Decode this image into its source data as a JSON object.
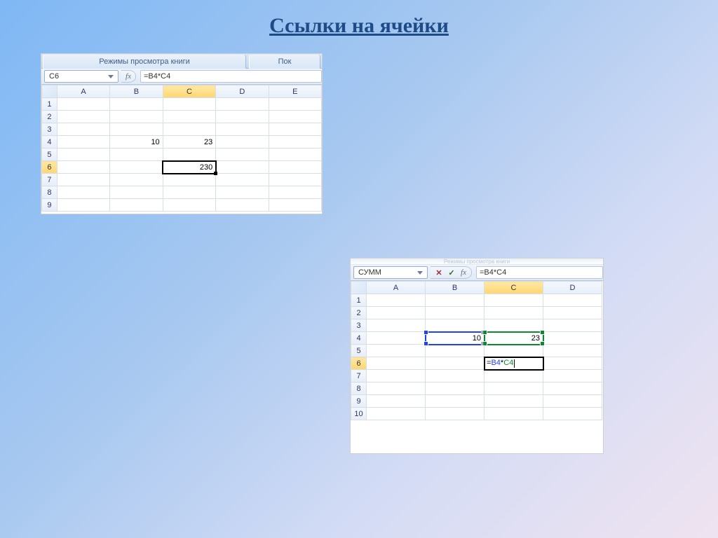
{
  "title": "Ссылки на ячейки",
  "shot1": {
    "ribbon_tabs": [
      "Режимы просмотра книги",
      "Пок"
    ],
    "name_box": "C6",
    "fx_label": "fx",
    "formula": "=B4*C4",
    "columns": [
      "A",
      "B",
      "C",
      "D",
      "E"
    ],
    "rows": [
      "1",
      "2",
      "3",
      "4",
      "5",
      "6",
      "7",
      "8",
      "9"
    ],
    "active_row": "6",
    "active_col": "C",
    "cells": {
      "B4": "10",
      "C4": "23",
      "C6": "230"
    },
    "selected": "C6"
  },
  "shot2": {
    "ribbon_hint": "Режимы просмотра книги",
    "name_box": "СУММ",
    "fx_cancel": "✕",
    "fx_enter": "✓",
    "fx_label": "fx",
    "formula": "=B4*C4",
    "columns": [
      "A",
      "B",
      "C",
      "D"
    ],
    "rows": [
      "1",
      "2",
      "3",
      "4",
      "5",
      "6",
      "7",
      "8",
      "9",
      "10"
    ],
    "active_row": "6",
    "active_col": "C",
    "cells": {
      "B4": "10",
      "C4": "23"
    },
    "edit_cell": "C6",
    "edit_prefix": "=",
    "edit_ref1": "B4",
    "edit_op": "*",
    "edit_ref2": "C4"
  }
}
